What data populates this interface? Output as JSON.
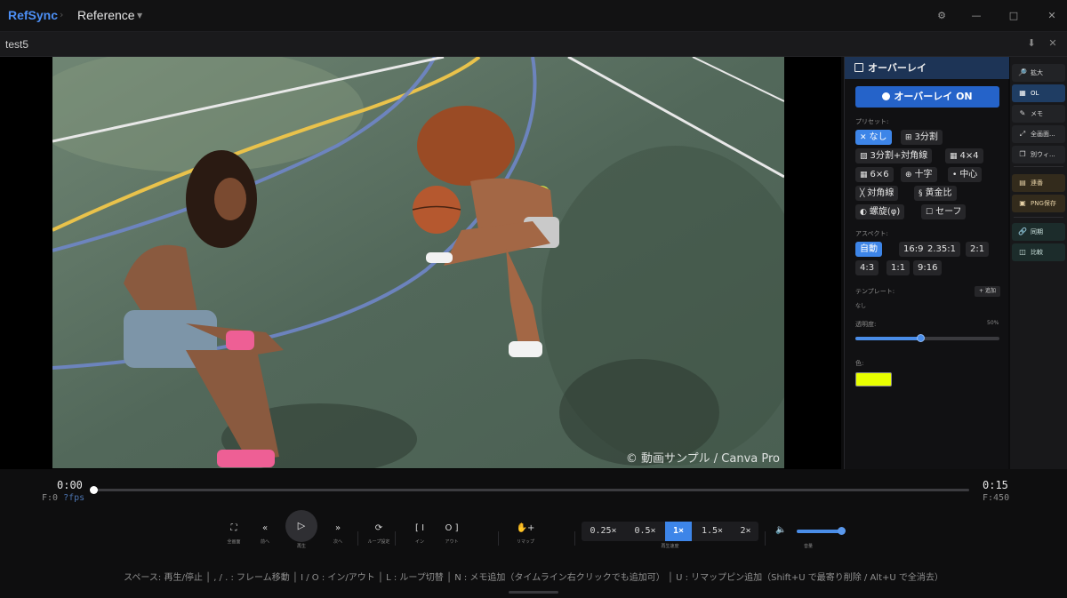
{
  "app": {
    "name": "RefSync",
    "breadcrumb": "Reference",
    "controls": {
      "settings_icon": "gear-icon",
      "minimize": "—",
      "maximize": "□",
      "close": "✕"
    }
  },
  "tab": {
    "name": "test5",
    "pin_icon": "pin-icon",
    "close_icon": "close-icon"
  },
  "video": {
    "watermark": "© 動画サンプル / Canva Pro"
  },
  "overlay_panel": {
    "title": "オーバーレイ",
    "toggle_label": "オーバーレイ ON",
    "preset_label": "プリセット:",
    "presets": [
      {
        "icon": "✕",
        "label": "なし",
        "active": true
      },
      {
        "icon": "⊞",
        "label": "3分割"
      },
      {
        "icon": "▨",
        "label": "3分割+対角線"
      },
      {
        "icon": "▦",
        "label": "4×4"
      },
      {
        "icon": "▦",
        "label": "6×6"
      },
      {
        "icon": "⊕",
        "label": "十字"
      },
      {
        "icon": "•",
        "label": "中心"
      },
      {
        "icon": "╳",
        "label": "対角線"
      },
      {
        "icon": "§",
        "label": "黄金比"
      },
      {
        "icon": "◐",
        "label": "螺旋(φ)"
      },
      {
        "icon": "☐",
        "label": "セーフ"
      }
    ],
    "aspect_label": "アスペクト:",
    "aspects": [
      {
        "label": "自動",
        "active": true
      },
      {
        "label": "16:9"
      },
      {
        "label": "2.35:1"
      },
      {
        "label": "2:1"
      },
      {
        "label": "4:3"
      },
      {
        "label": "1:1"
      },
      {
        "label": "9:16"
      }
    ],
    "template_label": "テンプレート:",
    "template_add": "+ 追加",
    "template_value": "なし",
    "opacity_label": "透明度:",
    "opacity_value": "50%",
    "opacity": 0.45,
    "color_label": "色:",
    "color": "#e8ff00"
  },
  "rail": {
    "items": [
      {
        "icon": "zoom-icon",
        "glyph": "🔎",
        "label": "拡大"
      },
      {
        "icon": "grid-icon",
        "glyph": "▦",
        "label": "OL",
        "active": true
      },
      {
        "icon": "memo-icon",
        "glyph": "✎",
        "label": "メモ"
      },
      {
        "icon": "fullscreen-icon",
        "glyph": "⤢",
        "label": "全画面..."
      },
      {
        "icon": "window-icon",
        "glyph": "❐",
        "label": "別ウィ..."
      },
      {
        "icon": "frames-icon",
        "glyph": "▤",
        "label": "連番"
      },
      {
        "icon": "camera-icon",
        "glyph": "▣",
        "label": "PNG保存"
      },
      {
        "icon": "link-icon",
        "glyph": "🔗",
        "label": "同期"
      },
      {
        "icon": "compare-icon",
        "glyph": "◫",
        "label": "比較"
      }
    ]
  },
  "transport": {
    "current_time": "0:00",
    "current_frame": "F:0",
    "fps": "?fps",
    "duration": "0:15",
    "total_frames": "F:450",
    "progress": 0.0,
    "buttons": [
      {
        "name": "fullscreen",
        "glyph": "⛶",
        "label": "全画面"
      },
      {
        "name": "prev",
        "glyph": "«",
        "label": "前へ"
      },
      {
        "name": "next",
        "glyph": "»",
        "label": "次へ"
      },
      {
        "name": "loop",
        "glyph": "⟳",
        "label": "ループ設定"
      },
      {
        "name": "in",
        "glyph": "[ I",
        "label": "イン"
      },
      {
        "name": "out",
        "glyph": "O ]",
        "label": "アウト"
      },
      {
        "name": "remap",
        "glyph": "✋+",
        "label": "リマップ"
      }
    ],
    "play_label": "再生",
    "play_glyph": "▷",
    "speeds": [
      "0.25×",
      "0.5×",
      "1×",
      "1.5×",
      "2×"
    ],
    "active_speed": "1×",
    "speed_label": "再生速度",
    "volume_label": "音量",
    "volume": 1.0,
    "volume_glyph": "🔈"
  },
  "shortcuts": "スペース: 再生/停止 │ , / . : フレーム移動 │ I / O : イン/アウト │ L : ループ切替 │ N : メモ追加（タイムライン右クリックでも追加可） │ U : リマップピン追加（Shift+U で最寄り削除 / Alt+U で全消去）"
}
